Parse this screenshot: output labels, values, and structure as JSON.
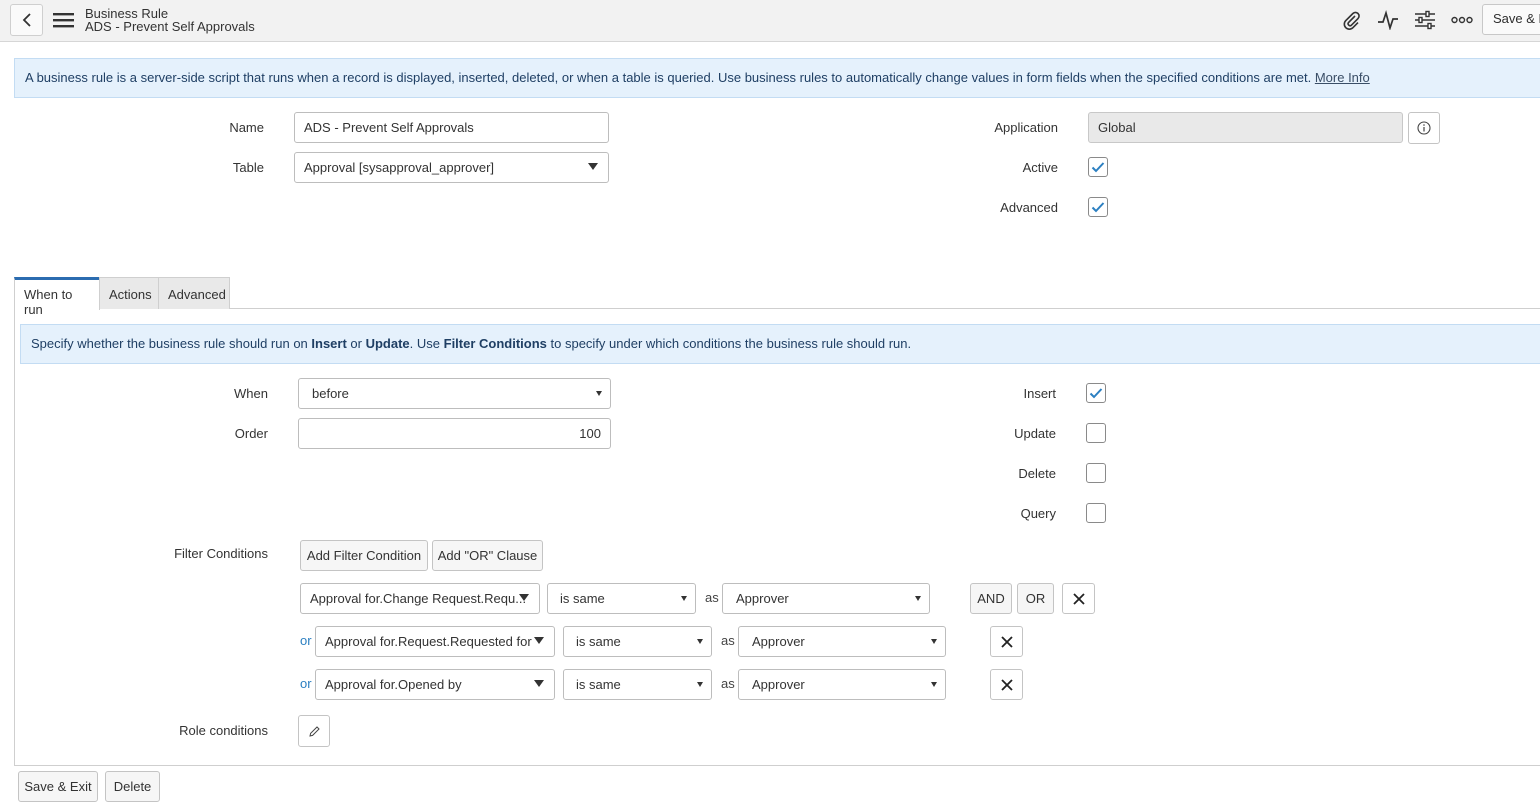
{
  "header": {
    "title": "Business Rule",
    "subtitle": "ADS - Prevent Self Approvals",
    "save_label": "Save & Exit",
    "icons": [
      "paperclip-icon",
      "activity-icon",
      "sliders-icon",
      "more-icon"
    ]
  },
  "info": {
    "text": "A business rule is a server-side script that runs when a record is displayed, inserted, deleted, or when a table is queried. Use business rules to automatically change values in form fields when the specified conditions are met. ",
    "link": "More Info"
  },
  "form": {
    "name_label": "Name",
    "name_value": "ADS - Prevent Self Approvals",
    "table_label": "Table",
    "table_value": "Approval [sysapproval_approver]",
    "application_label": "Application",
    "application_value": "Global",
    "active_label": "Active",
    "advanced_label": "Advanced"
  },
  "tabs": [
    {
      "label": "When to run",
      "active": true
    },
    {
      "label": "Actions",
      "active": false
    },
    {
      "label": "Advanced",
      "active": false
    }
  ],
  "when_tab": {
    "info_pre": "Specify whether the business rule should run on ",
    "info_insert": "Insert",
    "info_or": " or ",
    "info_update": "Update",
    "info_mid": ". Use ",
    "info_filter": "Filter Conditions",
    "info_post": " to specify under which conditions the business rule should run.",
    "when_label": "When",
    "when_value": "before",
    "order_label": "Order",
    "order_value": "100",
    "insert_label": "Insert",
    "update_label": "Update",
    "delete_label": "Delete",
    "query_label": "Query",
    "filter_label": "Filter Conditions",
    "add_filter": "Add Filter Condition",
    "add_or": "Add \"OR\" Clause",
    "conditions": [
      {
        "prefix": "",
        "field": "Approval for.Change Request.Requ...",
        "op": "is same",
        "as": "as",
        "value": "Approver"
      },
      {
        "prefix": "or",
        "field": "Approval for.Request.Requested for",
        "op": "is same",
        "as": "as",
        "value": "Approver"
      },
      {
        "prefix": "or",
        "field": "Approval for.Opened by",
        "op": "is same",
        "as": "as",
        "value": "Approver"
      }
    ],
    "and_label": "AND",
    "or_label": "OR",
    "role_label": "Role conditions"
  },
  "footer": {
    "save_exit": "Save & Exit",
    "delete": "Delete"
  },
  "colors": {
    "accent": "#2b6cb0",
    "info_bg": "#e5f1fc",
    "check": "#2b7fc1"
  }
}
